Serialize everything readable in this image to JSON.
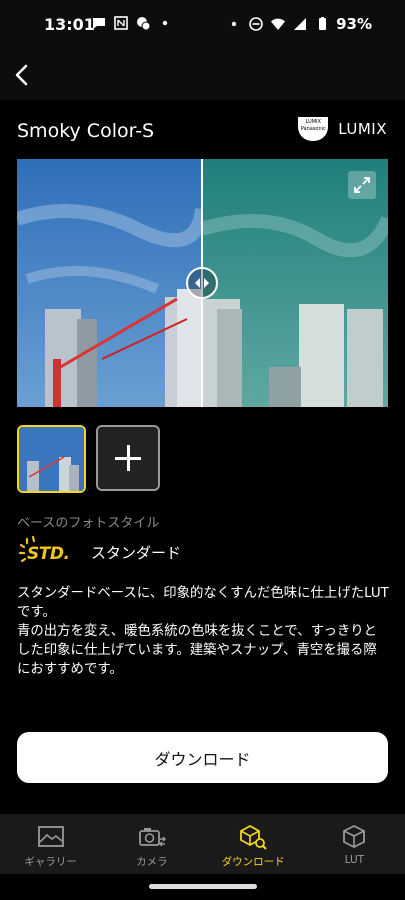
{
  "status_bar": {
    "time": "13:01",
    "battery": "93%"
  },
  "header": {
    "back_icon": "chevron-left-icon"
  },
  "style": {
    "title": "Smoky Color-S",
    "brand_badge_top": "LUMIX",
    "brand_badge_bottom": "Panasonic",
    "brand_name": "LUMIX"
  },
  "base_style": {
    "label": "ベースのフォトスタイル",
    "logo_text": "STD.",
    "name": "スタンダード"
  },
  "description": {
    "line1": "スタンダードベースに、印象的なくすんだ色味に仕上げたLUTです。",
    "line2": "青の出方を変え、暖色系統の色味を抜くことで、すっきりとした印象に仕上げています。建築やスナップ、青空を撮る際におすすめです。"
  },
  "actions": {
    "download_label": "ダウンロード"
  },
  "nav": {
    "items": [
      {
        "label": "ギャラリー",
        "icon": "gallery-icon"
      },
      {
        "label": "カメラ",
        "icon": "camera-icon"
      },
      {
        "label": "ダウンロード",
        "icon": "download-search-icon"
      },
      {
        "label": "LUT",
        "icon": "lut-cube-icon"
      }
    ],
    "active": "ダウンロード",
    "accent": "#f2d61e"
  }
}
